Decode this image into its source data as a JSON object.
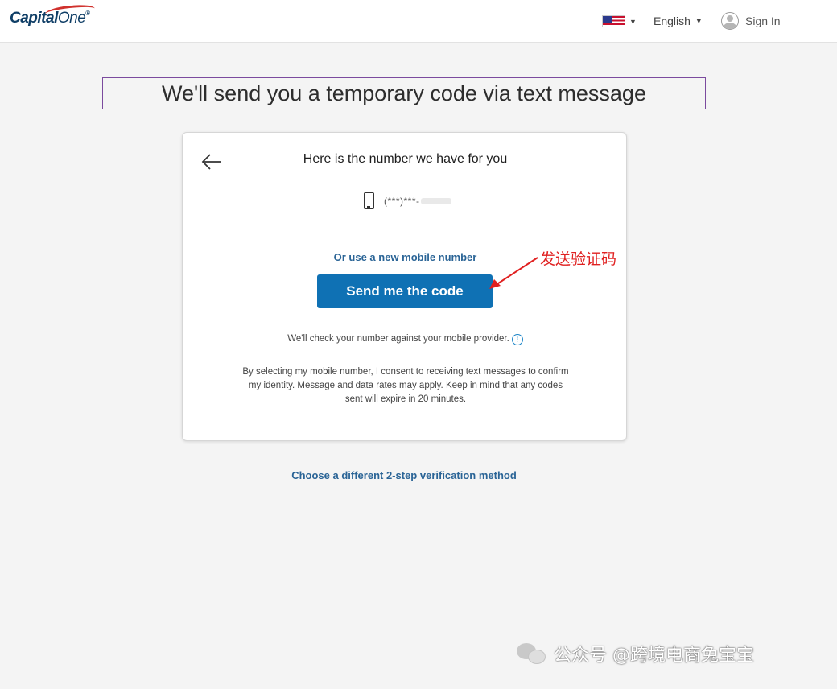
{
  "header": {
    "logo_main": "Capital",
    "logo_one": "One",
    "logo_reg": "®",
    "language": "English",
    "sign_in": "Sign In"
  },
  "page": {
    "title": "We'll send you a temporary code via text message"
  },
  "card": {
    "heading": "Here is the number we have for you",
    "phone_masked": "(***)***-",
    "new_number_link": "Or use a new mobile number",
    "send_button": "Send me the code",
    "check_text": "We'll check your number against your mobile provider.",
    "info_glyph": "i",
    "consent_text": "By selecting my mobile number, I consent to receiving text messages to confirm my identity. Message and data rates may apply. Keep in mind that any codes sent will expire in 20 minutes."
  },
  "alt_method_link": "Choose a different 2-step verification method",
  "annotation": {
    "text": "发送验证码",
    "color": "#e02020"
  },
  "watermark": {
    "text": "公众号 @跨境电商兔宝宝"
  },
  "colors": {
    "primary_button": "#0f71b4",
    "link": "#2a6496",
    "background": "#f4f4f4"
  },
  "icons": {
    "back": "arrow-left-icon",
    "phone": "mobile-phone-icon",
    "info": "info-icon",
    "user": "user-avatar-icon",
    "flag": "us-flag-icon"
  }
}
